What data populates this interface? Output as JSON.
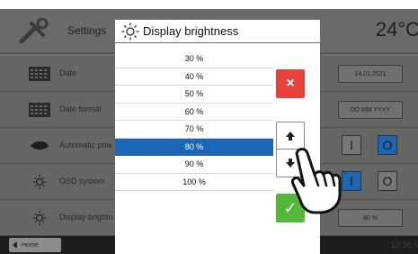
{
  "header": {
    "title": "Settings",
    "temperature": "24°C"
  },
  "rows": [
    {
      "label": "Date",
      "value": "14.01.2021",
      "icon": "calendar-icon"
    },
    {
      "label": "Date format",
      "value": "DD MM YYYY",
      "icon": "calendar-icon"
    },
    {
      "label": "Automatic pow",
      "icon": "leaf-icon",
      "toggle_on": "I",
      "toggle_off": "O"
    },
    {
      "label": "OSD system",
      "icon": "sun-icon",
      "toggle_on": "I",
      "toggle_off": "O"
    },
    {
      "label": "Display brightn",
      "value": "80 %",
      "icon": "sun-icon"
    }
  ],
  "footer": {
    "home_label": "Home",
    "time": "12:36:5"
  },
  "dialog": {
    "title": "Display brightness",
    "options": [
      "30 %",
      "40 %",
      "50 %",
      "60 %",
      "70 %",
      "80 %",
      "90 %",
      "100 %"
    ],
    "selected": "80 %",
    "buttons": {
      "cancel": "×",
      "up": "up-arrow",
      "down": "down-arrow",
      "ok": "✓"
    }
  },
  "colors": {
    "selected": "#1c66b5",
    "cancel": "#e7423a",
    "ok": "#54b73a",
    "toggle_active": "#1c66b5"
  }
}
